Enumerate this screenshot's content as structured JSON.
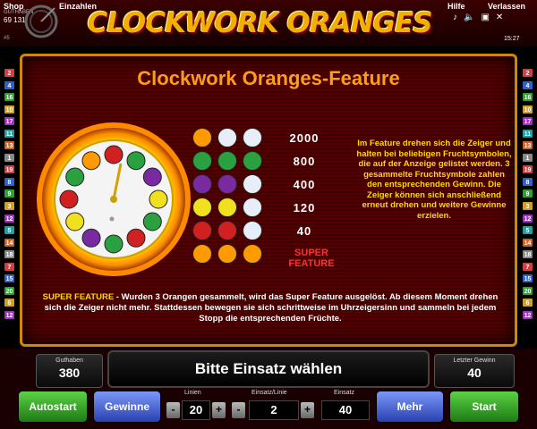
{
  "topbar": {
    "shop": "Shop",
    "shop_sub": "GUTHABEN",
    "balance_id": "69 131",
    "hash": "#5",
    "einzahlen": "Einzahlen",
    "hilfe": "Hilfe",
    "verlassen": "Verlassen",
    "time": "15:27",
    "logo": "CLOCKWORK ORANGES"
  },
  "sidebar": {
    "left": [
      "2",
      "4",
      "16",
      "10",
      "17",
      "11",
      "13",
      "1",
      "19",
      "8",
      "9",
      "3",
      "12",
      "5",
      "14",
      "18",
      "7",
      "15",
      "20",
      "6",
      "12"
    ],
    "right": [
      "2",
      "4",
      "16",
      "10",
      "17",
      "11",
      "13",
      "1",
      "19",
      "8",
      "9",
      "3",
      "12",
      "5",
      "14",
      "18",
      "7",
      "15",
      "20",
      "6",
      "12"
    ]
  },
  "panel": {
    "title": "Clockwork Oranges-Feature",
    "paytable": [
      {
        "value": "2000",
        "symbol": "orange"
      },
      {
        "value": "800",
        "symbol": "melon"
      },
      {
        "value": "400",
        "symbol": "plum"
      },
      {
        "value": "120",
        "symbol": "lemon"
      },
      {
        "value": "40",
        "symbol": "cherry"
      }
    ],
    "super_feature": "SUPER FEATURE",
    "info_right": "Im Feature drehen sich die Zeiger und halten bei beliebigen Fruchtsymbolen, die auf der Anzeige gelistet werden. 3 gesammelte Fruchtsymbole zahlen den entsprechenden Gewinn. Die Zeiger können sich anschließend erneut drehen und weitere Gewinne erzielen.",
    "info_bottom_highlight": "SUPER FEATURE",
    "info_bottom": " - Wurden 3 Orangen gesammelt, wird das Super Feature ausgelöst. Ab diesem Moment drehen sich die Zeiger nicht mehr. Stattdessen bewegen sie sich schrittweise im Uhrzeigersinn und sammeln bei jedem Stopp die entsprechenden Früchte."
  },
  "bottom": {
    "guthaben_label": "Guthaben",
    "guthaben_value": "380",
    "message": "Bitte Einsatz wählen",
    "letzter_label": "Letzter Gewinn",
    "letzter_value": "40",
    "autostart": "Autostart",
    "gewinne": "Gewinne",
    "linien_label": "Linien",
    "linien_value": "20",
    "einsatz_linie_label": "Einsatz/Linie",
    "einsatz_linie_value": "2",
    "einsatz_label": "Einsatz",
    "einsatz_value": "40",
    "mehr": "Mehr",
    "start": "Start",
    "minus": "-",
    "plus": "+"
  },
  "colors": {
    "accent": "#ff9c1a",
    "info_text": "#ffd800",
    "super_feature": "#ff3030",
    "button_green": "#3aa82a",
    "button_blue": "#4a64d8"
  }
}
